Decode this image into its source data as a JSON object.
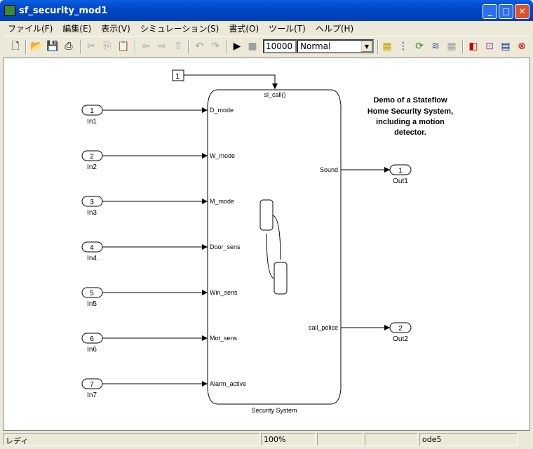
{
  "window": {
    "title": "sf_security_mod1"
  },
  "menu": [
    "ファイル(F)",
    "編集(E)",
    "表示(V)",
    "シミュレーション(S)",
    "書式(O)",
    "ツール(T)",
    "ヘルプ(H)"
  ],
  "toolbar": {
    "stop_time": "10000",
    "sim_mode": "Normal"
  },
  "diagram": {
    "inports": [
      {
        "num": "1",
        "name": "In1",
        "port": "D_mode"
      },
      {
        "num": "2",
        "name": "In2",
        "port": "W_mode"
      },
      {
        "num": "3",
        "name": "In3",
        "port": "M_mode"
      },
      {
        "num": "4",
        "name": "In4",
        "port": "Door_sens"
      },
      {
        "num": "5",
        "name": "In5",
        "port": "Win_sens"
      },
      {
        "num": "6",
        "name": "In6",
        "port": "Mot_sens"
      },
      {
        "num": "7",
        "name": "In7",
        "port": "Alarm_active"
      }
    ],
    "outports": [
      {
        "num": "1",
        "name": "Out1",
        "port": "Sound"
      },
      {
        "num": "2",
        "name": "Out2",
        "port": "call_police"
      }
    ],
    "trigger": {
      "value": "1",
      "port": "sl_call()"
    },
    "block_name": "Security System",
    "annotation": [
      "Demo of a Stateflow",
      "Home Security System,",
      "including a motion",
      "detector."
    ]
  },
  "status": {
    "state": "レディ",
    "zoom": "100%",
    "solver": "ode5"
  }
}
